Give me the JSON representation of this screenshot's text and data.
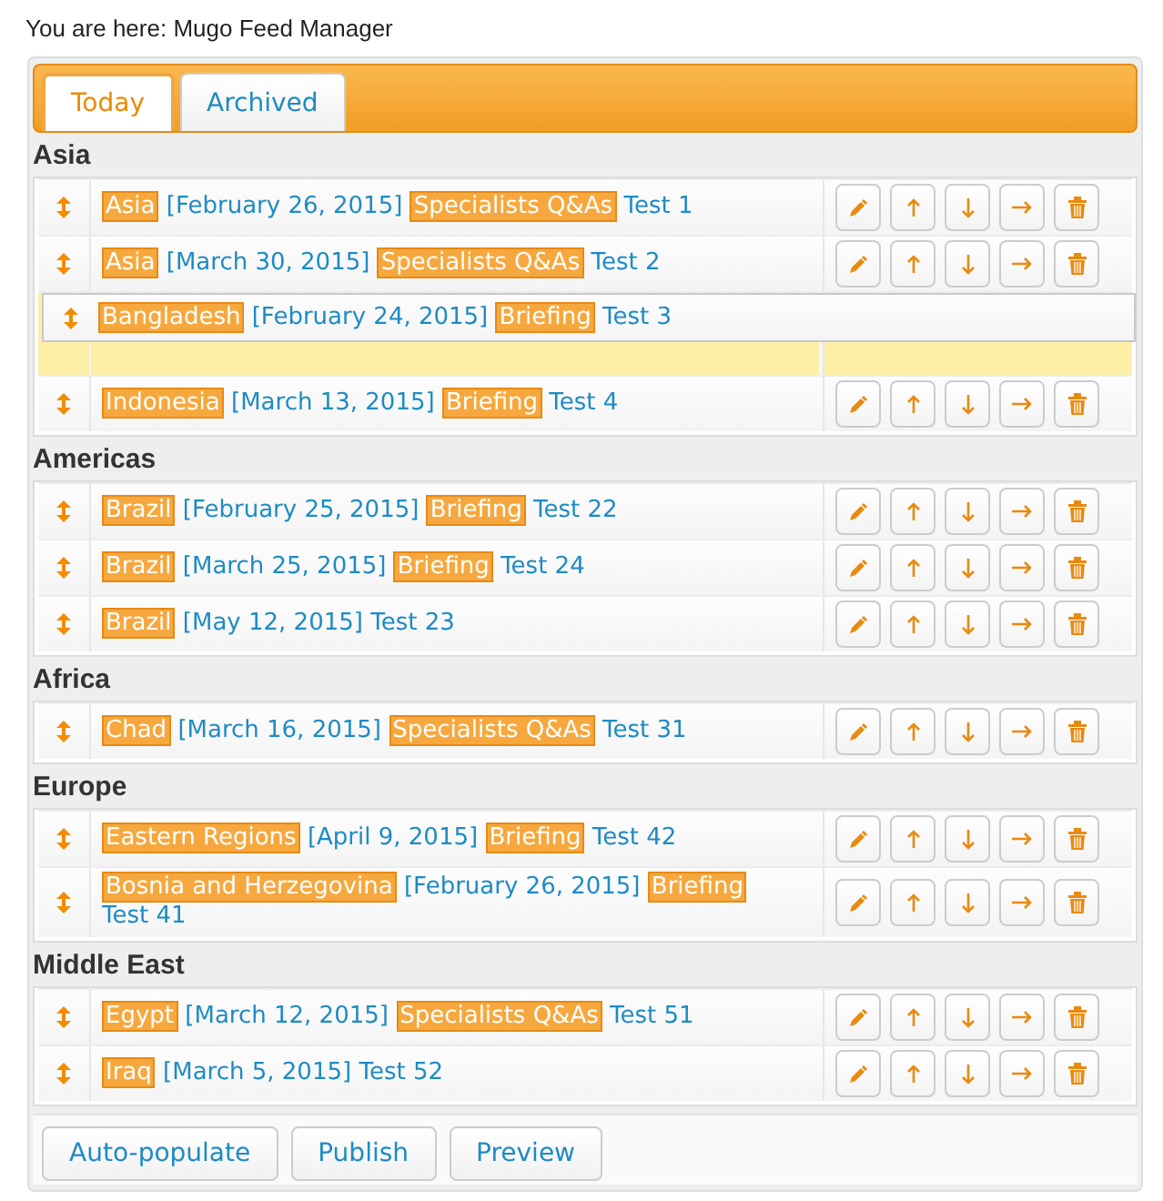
{
  "breadcrumb": "You are here: Mugo Feed Manager",
  "tabs": [
    {
      "label": "Today",
      "selected": true
    },
    {
      "label": "Archived",
      "selected": false
    }
  ],
  "sections": [
    {
      "title": "Asia",
      "rows": [
        {
          "kind": "entry",
          "region": "Asia",
          "date": "[February 26, 2015]",
          "type": "Specialists Q&As",
          "title": "Test 1"
        },
        {
          "kind": "entry",
          "region": "Asia",
          "date": "[March 30, 2015]",
          "type": "Specialists Q&As",
          "title": "Test 2"
        },
        {
          "kind": "placeholder",
          "dragged": {
            "region": "Bangladesh",
            "date": "[February 24, 2015]",
            "type": "Briefing",
            "title": "Test 3"
          }
        },
        {
          "kind": "entry",
          "region": "Indonesia",
          "date": "[March 13, 2015]",
          "type": "Briefing",
          "title": "Test 4"
        }
      ]
    },
    {
      "title": "Americas",
      "rows": [
        {
          "kind": "entry",
          "region": "Brazil",
          "date": "[February 25, 2015]",
          "type": "Briefing",
          "title": "Test 22"
        },
        {
          "kind": "entry",
          "region": "Brazil",
          "date": "[March 25, 2015]",
          "type": "Briefing",
          "title": "Test 24"
        },
        {
          "kind": "entry",
          "region": "Brazil",
          "date": "[May 12, 2015]",
          "title": "Test 23"
        }
      ]
    },
    {
      "title": "Africa",
      "rows": [
        {
          "kind": "entry",
          "region": "Chad",
          "date": "[March 16, 2015]",
          "type": "Specialists Q&As",
          "title": "Test 31"
        }
      ]
    },
    {
      "title": "Europe",
      "rows": [
        {
          "kind": "entry",
          "region": "Eastern Regions",
          "date": "[April 9, 2015]",
          "type": "Briefing",
          "title": "Test 42"
        },
        {
          "kind": "entry",
          "region": "Bosnia and Herzegovina",
          "date": "[February 26, 2015]",
          "type": "Briefing",
          "title": "Test 41"
        }
      ]
    },
    {
      "title": "Middle East",
      "rows": [
        {
          "kind": "entry",
          "region": "Egypt",
          "date": "[March 12, 2015]",
          "type": "Specialists Q&As",
          "title": "Test 51"
        },
        {
          "kind": "entry",
          "region": "Iraq",
          "date": "[March 5, 2015]",
          "title": "Test 52"
        }
      ]
    }
  ],
  "buttons": [
    "Auto-populate",
    "Publish",
    "Preview"
  ]
}
